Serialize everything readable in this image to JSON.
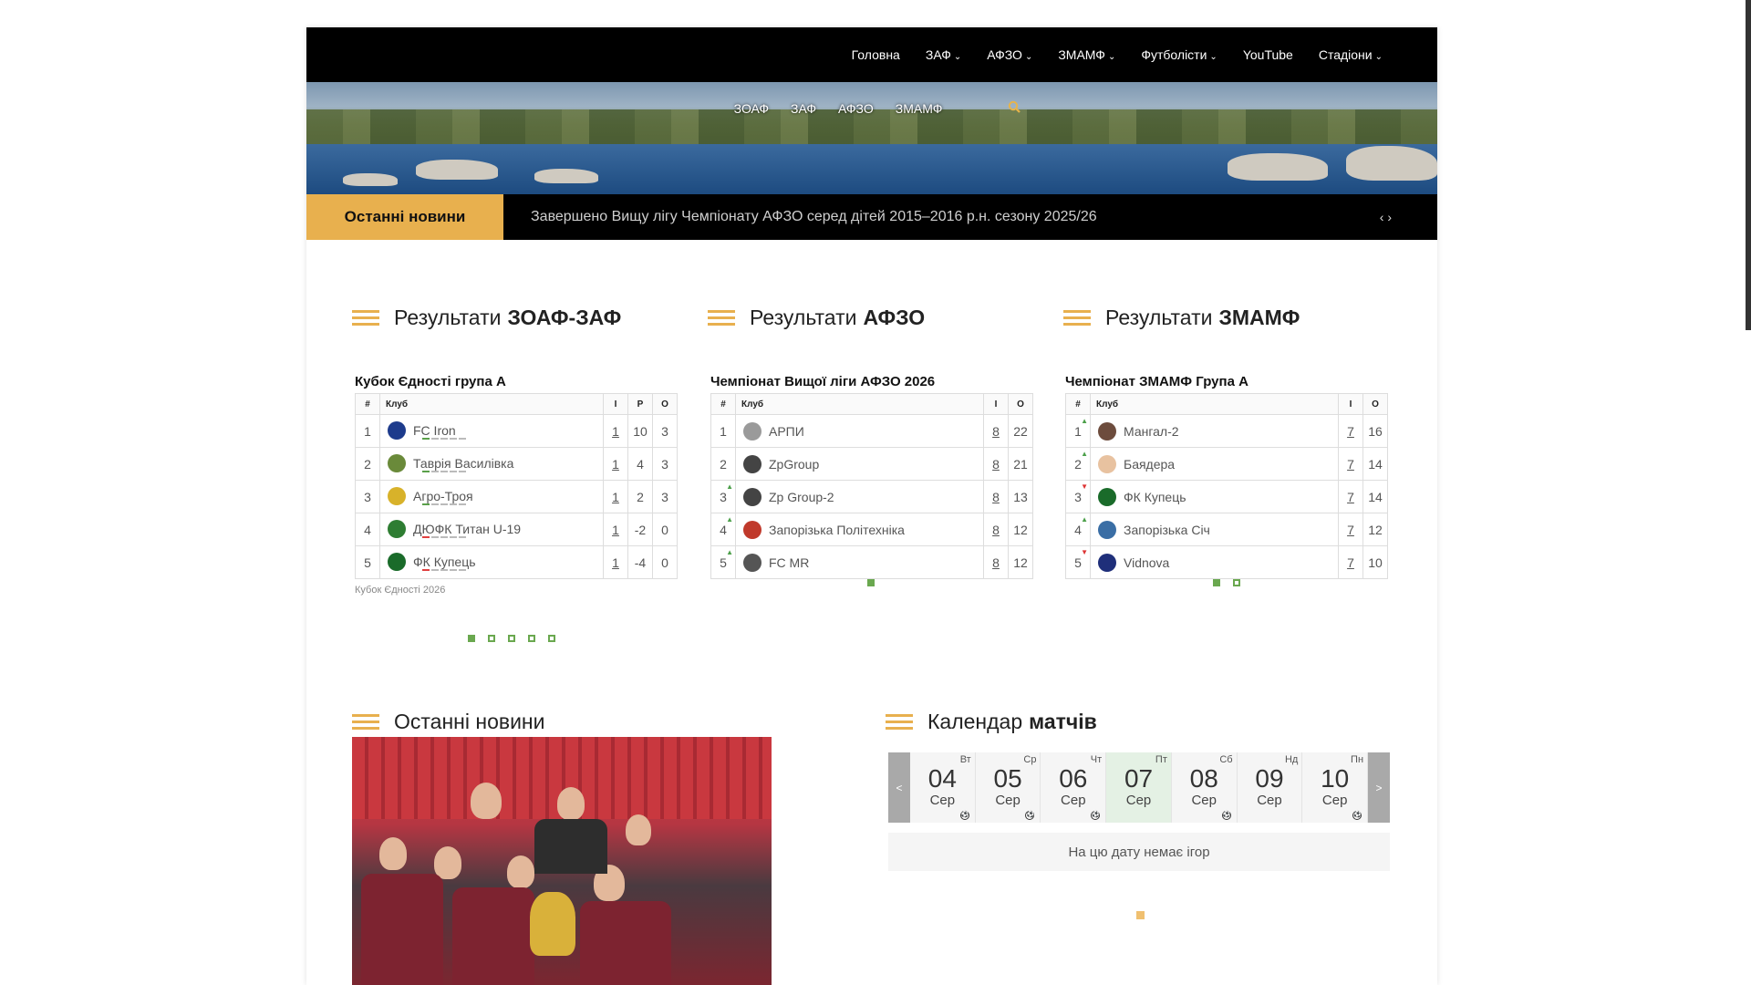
{
  "nav": {
    "items": [
      {
        "label": "Головна",
        "dropdown": false
      },
      {
        "label": "ЗАФ",
        "dropdown": true
      },
      {
        "label": "АФЗО",
        "dropdown": true
      },
      {
        "label": "ЗМАМФ",
        "dropdown": true
      },
      {
        "label": "Футболісти",
        "dropdown": true
      },
      {
        "label": "YouTube",
        "dropdown": false
      },
      {
        "label": "Стадіони",
        "dropdown": true
      }
    ],
    "chevron": "⌄"
  },
  "subnav": {
    "items": [
      "ЗОАФ",
      "ЗАФ",
      "АФЗО",
      "ЗМАМФ"
    ],
    "search_icon": "search-icon"
  },
  "ticker": {
    "label": "Останні новини",
    "text": "Завершено Вищу лігу Чемпіонату АФЗО серед дітей 2015–2016 р.н. сезону 2025/26",
    "arrows": "‹ ›"
  },
  "sections": {
    "zoaf": {
      "prefix": "Результати",
      "bold": "ЗОАФ-ЗАФ"
    },
    "afzo": {
      "prefix": "Результати",
      "bold": "АФЗО"
    },
    "zmamf": {
      "prefix": "Результати",
      "bold": "ЗМАМФ"
    },
    "news": {
      "prefix": "Останні новини",
      "bold": ""
    },
    "calendar": {
      "prefix": "Календар",
      "bold": "матчів"
    }
  },
  "tables": {
    "zoaf": {
      "caption": "Кубок Єдності група А",
      "headers": [
        "#",
        "Клуб",
        "І",
        "Р",
        "О"
      ],
      "rows": [
        {
          "pos": "1",
          "club": "FC Iron",
          "played": "1",
          "diff": "10",
          "points": "3",
          "color": "#1d3b8c"
        },
        {
          "pos": "2",
          "club": "Таврія Василівка",
          "played": "1",
          "diff": "4",
          "points": "3",
          "color": "#6a8a3a"
        },
        {
          "pos": "3",
          "club": "Агро-Троя",
          "played": "1",
          "diff": "2",
          "points": "3",
          "color": "#d8b22a"
        },
        {
          "pos": "4",
          "club": "ДЮФК Титан U-19",
          "played": "1",
          "diff": "-2",
          "points": "0",
          "color": "#2e7d32"
        },
        {
          "pos": "5",
          "club": "ФК Купець",
          "played": "1",
          "diff": "-4",
          "points": "0",
          "color": "#1a6b2a"
        }
      ],
      "note": "Кубок Єдності 2026"
    },
    "afzo": {
      "caption": "Чемпіонат Вищої ліги АФЗО 2026",
      "headers": [
        "#",
        "Клуб",
        "І",
        "О"
      ],
      "rows": [
        {
          "pos": "1",
          "club": "АРПИ",
          "played": "8",
          "points": "22",
          "color": "#9a9a9a"
        },
        {
          "pos": "2",
          "club": "ZpGroup",
          "played": "8",
          "points": "21",
          "color": "#444444"
        },
        {
          "pos": "3",
          "club": "Zp Group-2",
          "played": "8",
          "points": "13",
          "color": "#444444"
        },
        {
          "pos": "4",
          "club": "Запорізька Політехніка",
          "played": "8",
          "points": "12",
          "color": "#c0392b"
        },
        {
          "pos": "5",
          "club": "FC MR",
          "played": "8",
          "points": "12",
          "color": "#555555"
        }
      ]
    },
    "zmamf": {
      "caption": "Чемпіонат ЗМАМФ Група А",
      "headers": [
        "#",
        "Клуб",
        "І",
        "О"
      ],
      "rows": [
        {
          "pos": "1",
          "club": "Мангал-2",
          "played": "7",
          "points": "16",
          "color": "#6d4c3d"
        },
        {
          "pos": "2",
          "club": "Баядера",
          "played": "7",
          "points": "14",
          "color": "#e8c2a0"
        },
        {
          "pos": "3",
          "club": "ФК Купець",
          "played": "7",
          "points": "14",
          "color": "#1a6b2a"
        },
        {
          "pos": "4",
          "club": "Запорізька Січ",
          "played": "7",
          "points": "12",
          "color": "#3a6ea5"
        },
        {
          "pos": "5",
          "club": "Vidnova",
          "played": "7",
          "points": "10",
          "color": "#1f2f7a"
        }
      ]
    }
  },
  "calendar": {
    "prev": "<",
    "next": ">",
    "days": [
      {
        "dow": "Вт",
        "num": "04",
        "mon": "Сер",
        "has_game": true
      },
      {
        "dow": "Ср",
        "num": "05",
        "mon": "Сер",
        "has_game": true
      },
      {
        "dow": "Чт",
        "num": "06",
        "mon": "Сер",
        "has_game": true
      },
      {
        "dow": "Пт",
        "num": "07",
        "mon": "Сер",
        "has_game": false,
        "active": true
      },
      {
        "dow": "Сб",
        "num": "08",
        "mon": "Сер",
        "has_game": true
      },
      {
        "dow": "Нд",
        "num": "09",
        "mon": "Сер",
        "has_game": false
      },
      {
        "dow": "Пн",
        "num": "10",
        "mon": "Сер",
        "has_game": true
      }
    ],
    "empty_text": "На цю дату немає ігор"
  },
  "colors": {
    "accent": "#e8b04e",
    "green": "#6aa84f",
    "nav_bg": "#000000"
  }
}
